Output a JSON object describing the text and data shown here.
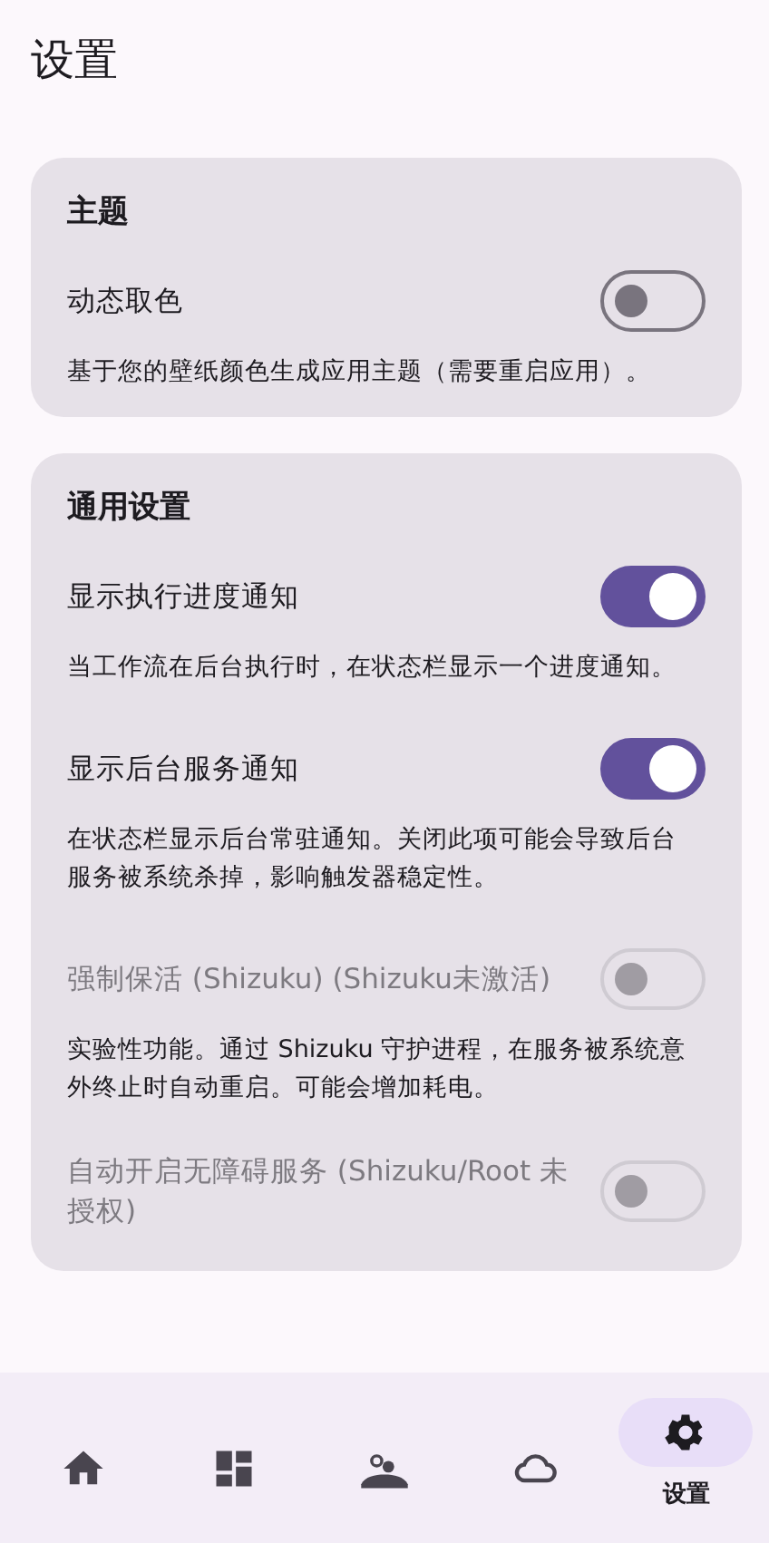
{
  "app_bar": {
    "title": "设置"
  },
  "sections": [
    {
      "title": "主题",
      "items": [
        {
          "kind": "switch",
          "label": "动态取色",
          "on": false,
          "disabled": false,
          "description": "基于您的壁纸颜色生成应用主题（需要重启应用）。"
        }
      ]
    },
    {
      "title": "通用设置",
      "items": [
        {
          "kind": "switch",
          "label": "显示执行进度通知",
          "on": true,
          "disabled": false,
          "description": "当工作流在后台执行时，在状态栏显示一个进度通知。"
        },
        {
          "kind": "switch",
          "label": "显示后台服务通知",
          "on": true,
          "disabled": false,
          "description": "在状态栏显示后台常驻通知。关闭此项可能会导致后台服务被系统杀掉，影响触发器稳定性。"
        },
        {
          "kind": "switch",
          "label": "强制保活 (Shizuku) (Shizuku未激活)",
          "on": false,
          "disabled": true,
          "description": "实验性功能。通过 Shizuku 守护进程，在服务被系统意外终止时自动重启。可能会增加耗电。"
        },
        {
          "kind": "switch",
          "label": "自动开启无障碍服务 (Shizuku/Root 未授权)",
          "on": false,
          "disabled": true
        }
      ]
    }
  ],
  "nav": [
    {
      "selected": false
    },
    {
      "selected": false
    },
    {
      "selected": false
    },
    {
      "selected": false
    },
    {
      "label": "设置",
      "selected": true
    }
  ]
}
